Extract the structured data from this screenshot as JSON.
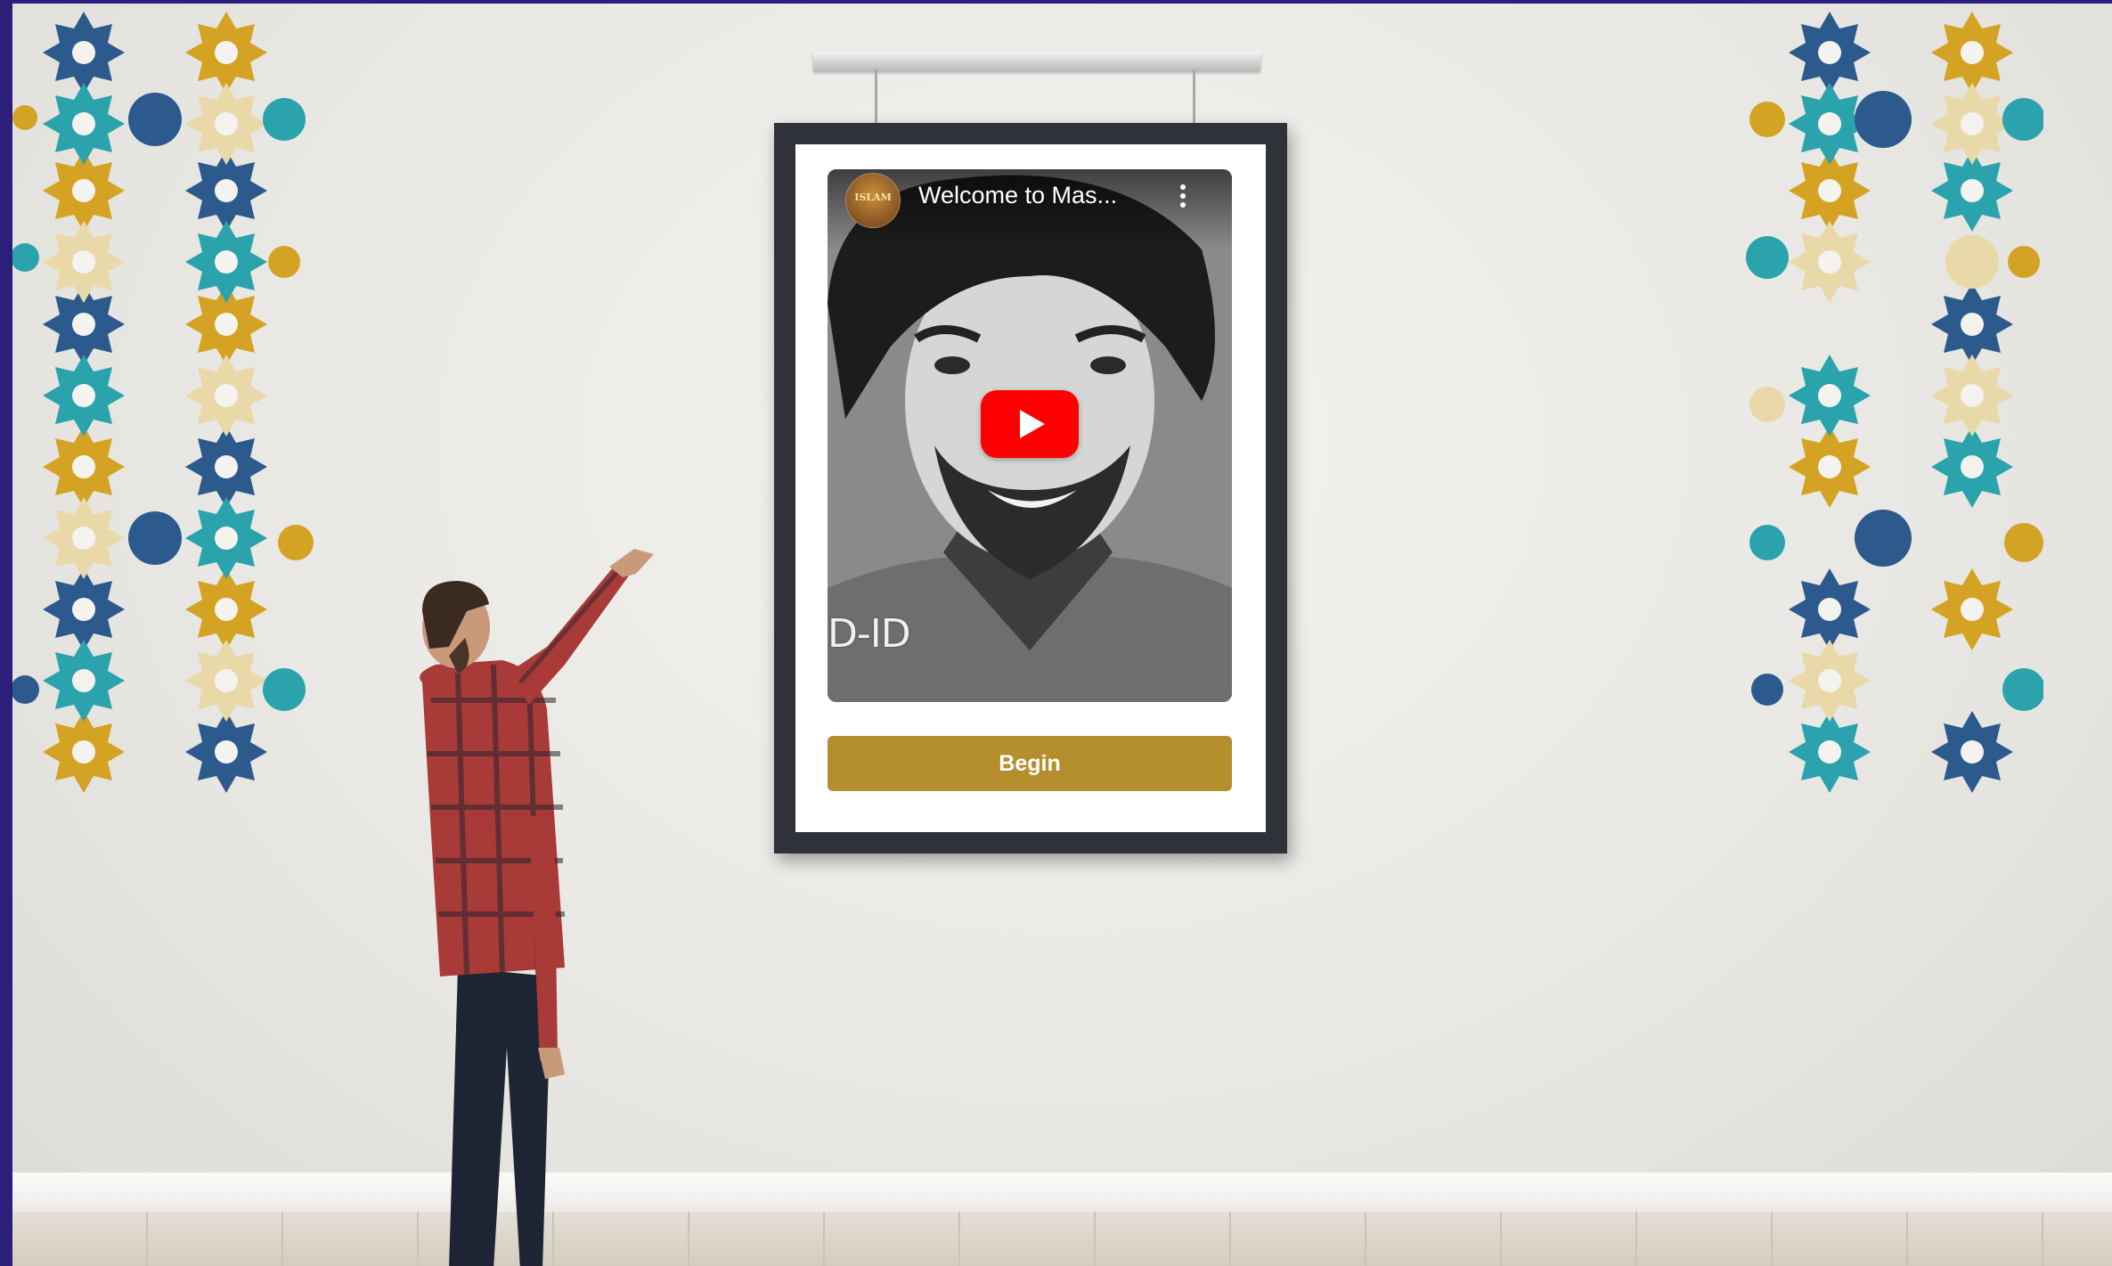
{
  "video": {
    "channel_avatar_text": "ISLAM",
    "title": "Welcome to Mas...",
    "watermark": "D-ID"
  },
  "poster": {
    "begin_label": "Begin"
  },
  "colors": {
    "begin_button": "#b58f2d",
    "play_button": "#ff0000",
    "frame": "#2f3238",
    "page_border": "#2b1f7a"
  },
  "icons": {
    "play": "play-icon",
    "menu": "kebab-menu-icon"
  }
}
